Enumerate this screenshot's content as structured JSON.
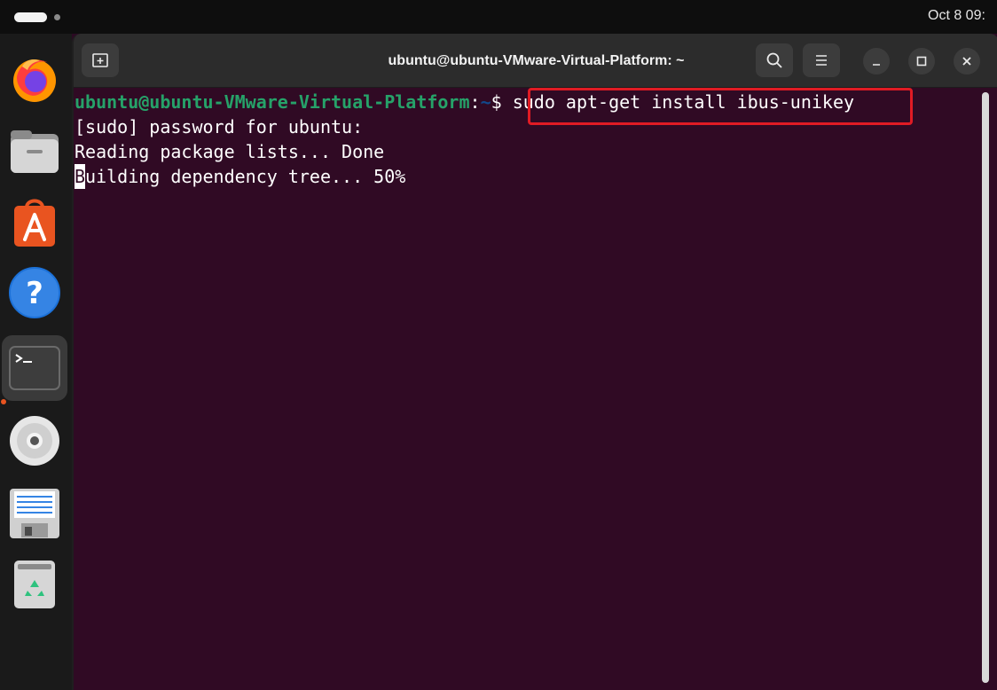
{
  "topbar": {
    "clock": "Oct 8  09:"
  },
  "dock": {
    "items": [
      {
        "name": "firefox-icon"
      },
      {
        "name": "files-icon"
      },
      {
        "name": "app-center-icon"
      },
      {
        "name": "help-icon"
      },
      {
        "name": "terminal-icon"
      },
      {
        "name": "disc-icon"
      },
      {
        "name": "text-editor-icon"
      },
      {
        "name": "trash-icon"
      }
    ],
    "accent": "#e95420"
  },
  "window": {
    "title": "ubuntu@ubuntu-VMware-Virtual-Platform: ~"
  },
  "terminal": {
    "prompt_user": "ubuntu@ubuntu-VMware-Virtual-Platform",
    "prompt_colon": ":",
    "prompt_path": "~",
    "prompt_symbol": "$",
    "command": "sudo apt-get install ibus-unikey",
    "lines": [
      "[sudo] password for ubuntu:",
      "Reading package lists... Done"
    ],
    "cursor_char": "B",
    "last_line_rest": "uilding dependency tree... 50%",
    "colors": {
      "background": "#300a24",
      "user": "#26a269",
      "path": "#12488b",
      "highlight": "#e01b24"
    }
  }
}
